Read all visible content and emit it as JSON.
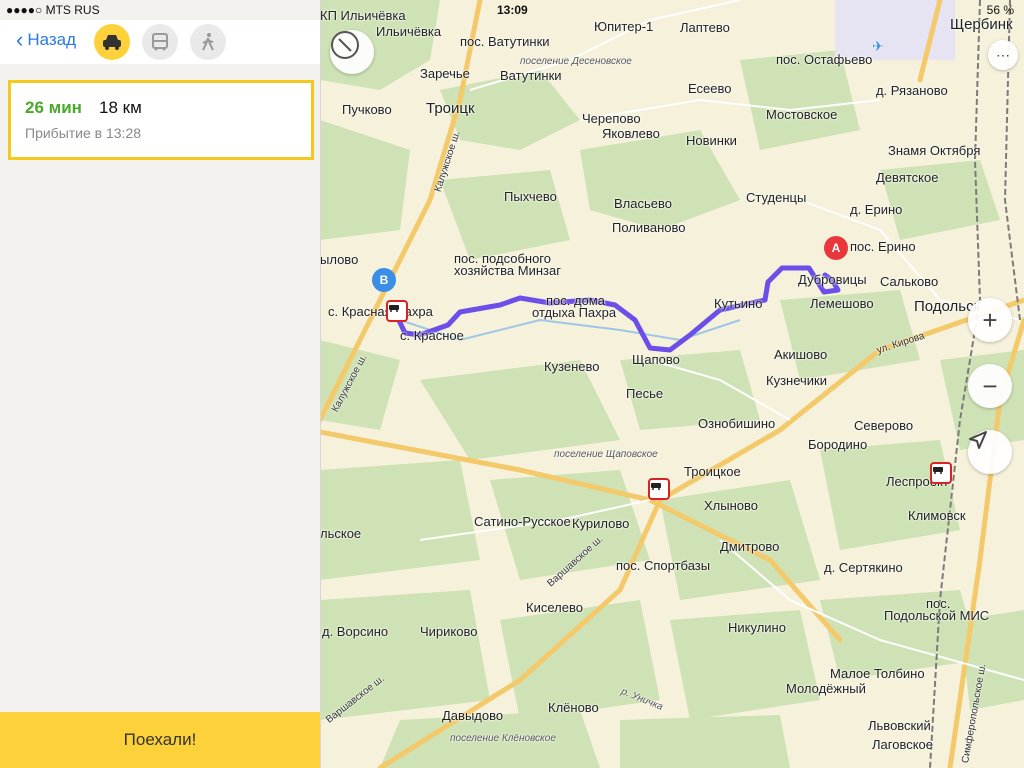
{
  "status": {
    "carrier": "●●●●○ MTS RUS",
    "time": "13:09",
    "battery": "56 %"
  },
  "panel": {
    "back_label": "Назад",
    "modes": [
      "car-icon",
      "bus-icon",
      "walk-icon"
    ],
    "active_mode": "car",
    "route": {
      "duration": "26 мин",
      "distance": "18 км",
      "arrival": "Прибытие в 13:28"
    },
    "go_label": "Поехали!"
  },
  "map": {
    "labels": {
      "kp_ilichevka": "КП Ильичёвка",
      "ilichevka": "Ильичёвка",
      "vatutinki_pos": "пос. Ватутинки",
      "vatutinki": "Ватутинки",
      "yupiter": "Юпитер-1",
      "laptevo": "Лаптево",
      "shcherbinka": "Щербинк",
      "ostafevo": "пос. Остафьево",
      "zarechye": "Заречье",
      "desenovskoe": "поселение Десеновское",
      "eseevo": "Есеево",
      "ryazanovo": "д. Рязаново",
      "puchkovo": "Пучково",
      "troitsk": "Троицк",
      "cherepovo": "Черепово",
      "mostovskoe": "Мостовское",
      "yakovlevo": "Яковлево",
      "novinki": "Новинки",
      "znamya": "Знамя Октября",
      "devyatskoe": "Девятское",
      "pyhchevo": "Пыхчево",
      "vlasyevo": "Власьево",
      "studentsy": "Студенцы",
      "d_erino": "д. Ерино",
      "polivanovo": "Поливаново",
      "podsob1": "пос. подсобного",
      "podsob2": "хозяйства Минзаг",
      "pos_erino": "пос. Ерино",
      "yilovo": "ылово",
      "dubrovitsy": "Дубровицы",
      "salkovo": "Сальково",
      "s_krasnaya": "с. Красная Пахра",
      "pos_doma": "пос. дома",
      "otdyha": "отдыха Пахра",
      "kutyino": "Кутьино",
      "lemeshovo": "Лемешово",
      "podolsk": "Подольск",
      "s_krasnoe": "с. Красное",
      "kirova": "ул. Кирова",
      "akishovo": "Акишово",
      "shchapovo": "Щапово",
      "kuzenevo": "Кузенево",
      "kuznechiki": "Кузнечики",
      "pesye": "Песье",
      "ozn": "Ознобишино",
      "severovo": "Северово",
      "borodino": "Бородино",
      "pos_shchap": "поселение Щаповское",
      "troitskoe": "Троицкое",
      "lesprokt": "Леспроект",
      "satino": "Сатино-Русское",
      "kurilovo": "Курилово",
      "hlynovo": "Хлыново",
      "klimovsk": "Климовск",
      "lskoe": "льское",
      "dmitrovo": "Дмитрово",
      "sportbazy": "пос. Спортбазы",
      "sertyakino": "д. Сертякино",
      "kiselevo": "Киселево",
      "pos_pod": "пос.",
      "podolskoy_mis": "Подольской МИС",
      "vorsino": "д. Ворсино",
      "chirikovo": "Чириково",
      "nikulino": "Никулино",
      "maloe_tolbino": "Малое Толбино",
      "molodezhny": "Молодёжный",
      "unichka": "р. Уничка",
      "davydovo": "Давыдово",
      "klenovo": "Клёново",
      "lvovsky": "Львовский",
      "pos_klen": "поселение Клёновское",
      "lagovskoe": "Лаговское",
      "kaluzh1": "Калужское ш.",
      "kaluzh2": "Калужское ш.",
      "varsh1": "Варшавское ш.",
      "varsh2": "Варшавское ш.",
      "simf": "Симферопольское ш."
    },
    "pins": {
      "start": "A",
      "end": "B"
    },
    "colors": {
      "route": "#6c4ee8",
      "forest": "#cfe2b5",
      "land": "#f5f1db",
      "road": "#f3c96a",
      "pin_a": "#e8363b",
      "pin_b": "#3a8ee6"
    }
  }
}
